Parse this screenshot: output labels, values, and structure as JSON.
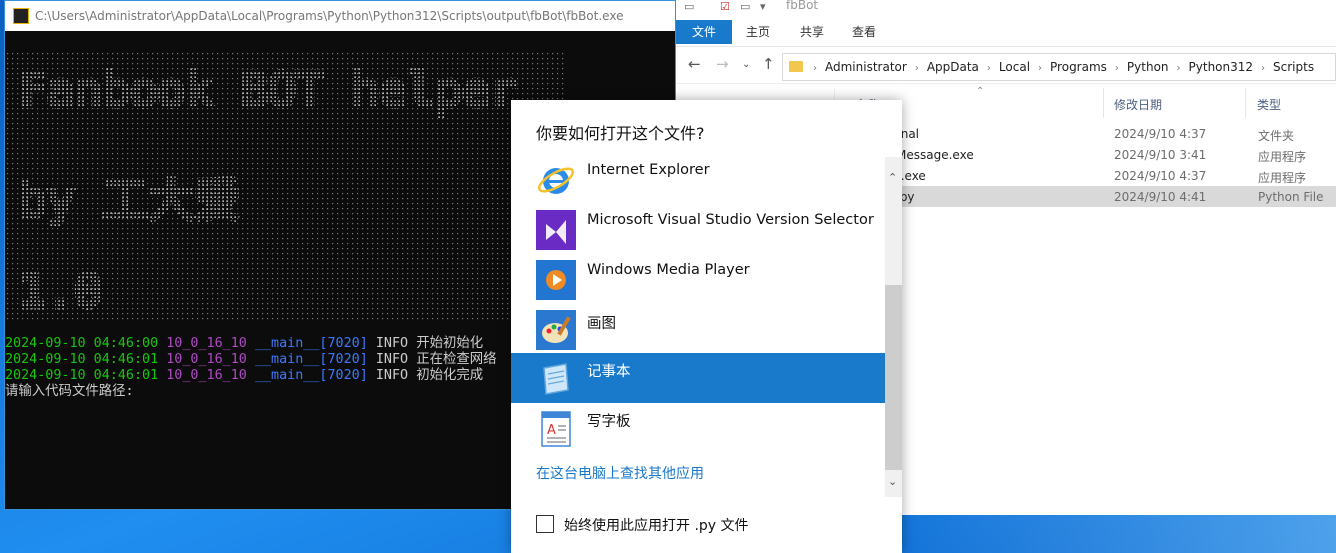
{
  "explorer": {
    "title": "fbBot",
    "ribbon_tabs": [
      "文件",
      "主页",
      "共享",
      "查看"
    ],
    "breadcrumb": [
      "Administrator",
      "AppData",
      "Local",
      "Programs",
      "Python",
      "Python312",
      "Scripts"
    ],
    "columns": {
      "name": "名称",
      "date": "修改日期",
      "type": "类型"
    },
    "files": [
      {
        "name": "rnal",
        "date": "2024/9/10 4:37",
        "type": "文件夹"
      },
      {
        "name": "Message.exe",
        "date": "2024/9/10 3:41",
        "type": "应用程序"
      },
      {
        "name": "t.exe",
        "date": "2024/9/10 4:37",
        "type": "应用程序"
      },
      {
        "name": ".py",
        "date": "2024/9/10 4:41",
        "type": "Python File",
        "selected": true
      }
    ]
  },
  "console": {
    "title": "C:\\Users\\Administrator\\AppData\\Local\\Programs\\Python\\Python312\\Scripts\\output\\fbBot\\fbBot.exe",
    "banner_lines": [
      "Fanbook BOT helper",
      "by 工大爱",
      "1.0"
    ],
    "logs": [
      {
        "time": "2024-09-10 04:46:00",
        "ver": "10_0_16_10",
        "mod": "__main__[7020]",
        "level": "INFO",
        "msg": "开始初始化"
      },
      {
        "time": "2024-09-10 04:46:01",
        "ver": "10_0_16_10",
        "mod": "__main__[7020]",
        "level": "INFO",
        "msg": "正在检查网络"
      },
      {
        "time": "2024-09-10 04:46:01",
        "ver": "10_0_16_10",
        "mod": "__main__[7020]",
        "level": "INFO",
        "msg": "初始化完成"
      }
    ],
    "prompt": "请输入代码文件路径:"
  },
  "dialog": {
    "title": "你要如何打开这个文件?",
    "apps": [
      {
        "label": "Internet Explorer",
        "icon": "ie-icon"
      },
      {
        "label": "Microsoft Visual Studio Version Selector",
        "icon": "vs-icon"
      },
      {
        "label": "Windows Media Player",
        "icon": "media-player-icon"
      },
      {
        "label": "画图",
        "icon": "paint-icon"
      },
      {
        "label": "记事本",
        "icon": "notepad-icon",
        "selected": true
      },
      {
        "label": "写字板",
        "icon": "wordpad-icon"
      }
    ],
    "more_link": "在这台电脑上查找其他应用",
    "always_use": "始终使用此应用打开 .py 文件"
  },
  "colors": {
    "accent": "#1979ca",
    "log_time": "#16c60c",
    "log_version": "#b148c6",
    "log_module": "#3b78ff"
  }
}
